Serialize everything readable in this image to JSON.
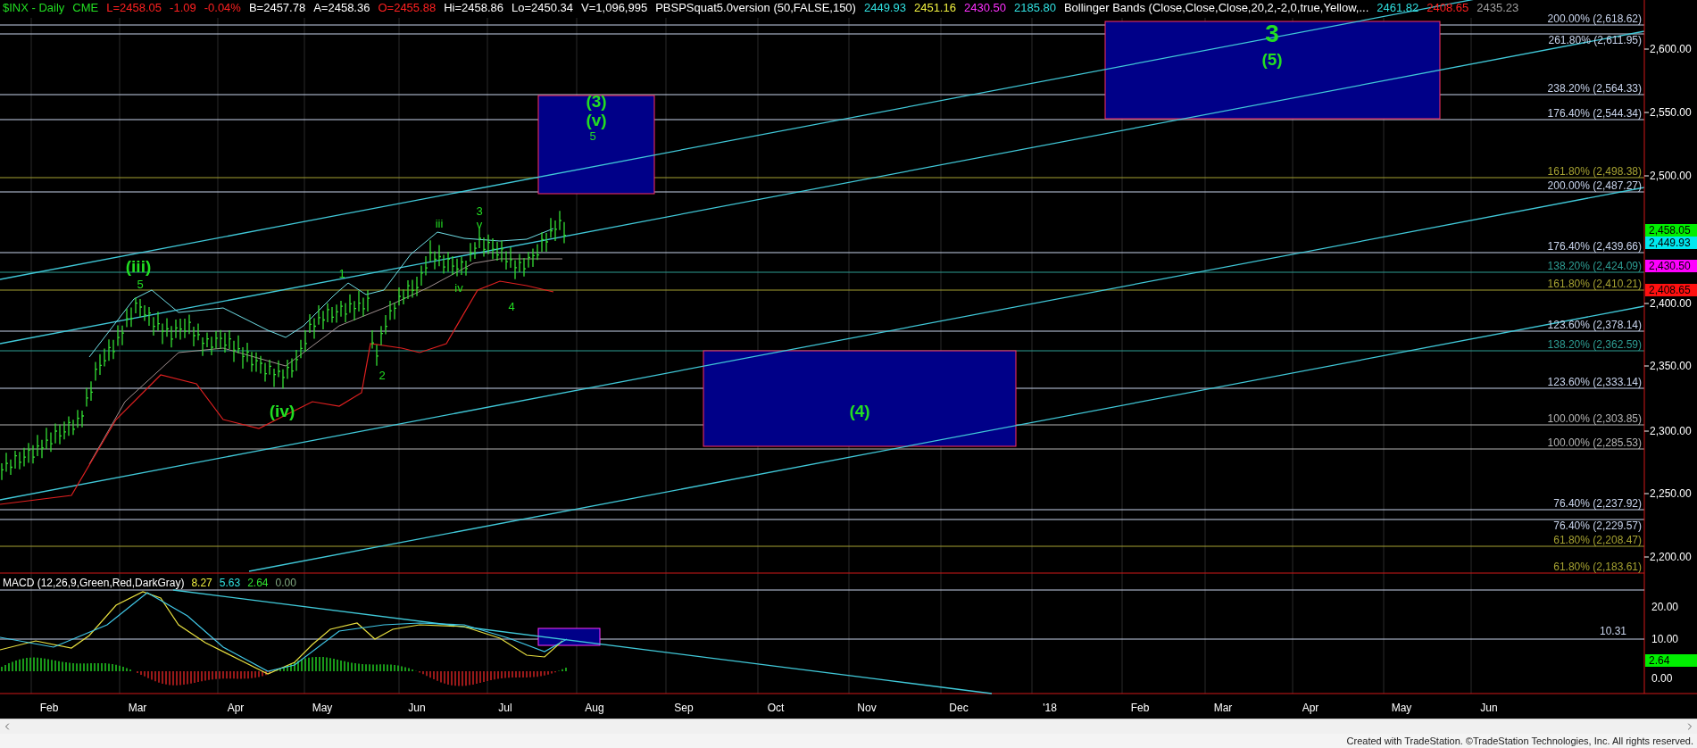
{
  "header": [
    {
      "text": "$INX - Daily",
      "color": "#22dd22"
    },
    {
      "text": "CME",
      "color": "#22dd22"
    },
    {
      "text": "L=2458.05",
      "color": "#ff2020"
    },
    {
      "text": "-1.09",
      "color": "#ff2020"
    },
    {
      "text": "-0.04%",
      "color": "#ff2020"
    },
    {
      "text": "B=2457.78",
      "color": "#ffffff"
    },
    {
      "text": "A=2458.36",
      "color": "#ffffff"
    },
    {
      "text": "O=2455.88",
      "color": "#ff2020"
    },
    {
      "text": "Hi=2458.86",
      "color": "#ffffff"
    },
    {
      "text": "Lo=2450.34",
      "color": "#ffffff"
    },
    {
      "text": "V=1,096,995",
      "color": "#ffffff"
    },
    {
      "text": "PBSPSquat5.0version (50,FALSE,150)",
      "color": "#ffffff"
    },
    {
      "text": "2449.93",
      "color": "#30e0e0"
    },
    {
      "text": "2451.16",
      "color": "#f0f040"
    },
    {
      "text": "2430.50",
      "color": "#ff30ff"
    },
    {
      "text": "2185.80",
      "color": "#30e0e0"
    },
    {
      "text": "Bollinger Bands (Close,Close,Close,20,2,-2,0,true,Yellow,...",
      "color": "#ffffff"
    },
    {
      "text": "2461.82",
      "color": "#30e0e0"
    },
    {
      "text": "2408.65",
      "color": "#ff2020"
    },
    {
      "text": "2435.23",
      "color": "#a0a0a0"
    }
  ],
  "fib_levels": [
    {
      "label": "200.00% (2,618.62)",
      "color": "#c8d4ec"
    },
    {
      "label": "261.80% (2,611.95)",
      "color": "#c8d4ec"
    },
    {
      "label": "238.20% (2,564.33)",
      "color": "#c8d4ec"
    },
    {
      "label": "176.40% (2,544.34)",
      "color": "#c8d4ec"
    },
    {
      "label": "161.80% (2,498.38)",
      "color": "#a6a232"
    },
    {
      "label": "200.00% (2,487.27)",
      "color": "#c8d4ec"
    },
    {
      "label": "176.40% (2,439.66)",
      "color": "#c8d4ec"
    },
    {
      "label": "138.20% (2,424.09)",
      "color": "#2e9e94"
    },
    {
      "label": "161.80% (2,410.21)",
      "color": "#a6a232"
    },
    {
      "label": "123.60% (2,378.14)",
      "color": "#c8d4ec"
    },
    {
      "label": "138.20% (2,362.59)",
      "color": "#2e9e94"
    },
    {
      "label": "123.60% (2,333.14)",
      "color": "#c8d4ec"
    },
    {
      "label": "100.00% (2,303.85)",
      "color": "#b4b4b4"
    },
    {
      "label": "100.00% (2,285.53)",
      "color": "#b4b4b4"
    },
    {
      "label": "76.40% (2,237.92)",
      "color": "#c8d4ec"
    },
    {
      "label": "76.40% (2,229.57)",
      "color": "#c8d4ec"
    },
    {
      "label": "61.80% (2,208.47)",
      "color": "#a6a232"
    },
    {
      "label": "61.80% (2,183.61)",
      "color": "#a6a232"
    }
  ],
  "wave_labels": [
    {
      "text": "3",
      "kind": "large"
    },
    {
      "text": "(5)",
      "kind": "major"
    },
    {
      "text": "(3)",
      "kind": "major"
    },
    {
      "text": "(v)",
      "kind": "major"
    },
    {
      "text": "5",
      "kind": "minor"
    },
    {
      "text": "(iii)",
      "kind": "major"
    },
    {
      "text": "5",
      "kind": "minor"
    },
    {
      "text": "iii",
      "kind": "minor"
    },
    {
      "text": "3",
      "kind": "minor"
    },
    {
      "text": "v",
      "kind": "minor"
    },
    {
      "text": "1",
      "kind": "minor"
    },
    {
      "text": "iv",
      "kind": "minor"
    },
    {
      "text": "4",
      "kind": "minor"
    },
    {
      "text": "2",
      "kind": "minor"
    },
    {
      "text": "(iv)",
      "kind": "major"
    },
    {
      "text": "(4)",
      "kind": "major"
    }
  ],
  "price_axis": [
    "2,600.00",
    "2,550.00",
    "2,500.00",
    "2,400.00",
    "2,350.00",
    "2,300.00",
    "2,250.00",
    "2,200.00"
  ],
  "price_tags": [
    {
      "text": "2,458.05",
      "color": "#00ee00"
    },
    {
      "text": "2,449.93",
      "color": "#00e8f0"
    },
    {
      "text": "2,430.50",
      "color": "#ff00ff"
    },
    {
      "text": "2,408.65",
      "color": "#ff1010"
    }
  ],
  "macd": {
    "title": "MACD (12,26,9,Green,Red,DarkGray)",
    "values": [
      {
        "text": "8.27",
        "color": "#f0f040"
      },
      {
        "text": "5.63",
        "color": "#30e0e0"
      },
      {
        "text": "2.64",
        "color": "#30e030"
      },
      {
        "text": "0.00",
        "color": "#80a880"
      }
    ],
    "axis": [
      "20.00",
      "10.00",
      "0.00"
    ],
    "level_label": "10.31",
    "tag": {
      "text": "2.64",
      "color": "#00ee00"
    }
  },
  "time_axis": [
    "Feb",
    "Mar",
    "Apr",
    "May",
    "Jun",
    "Jul",
    "Aug",
    "Sep",
    "Oct",
    "Nov",
    "Dec",
    "'18",
    "Feb",
    "Mar",
    "Apr",
    "May",
    "Jun"
  ],
  "footer": "Created with TradeStation. ©TradeStation Technologies, Inc. All rights reserved."
}
